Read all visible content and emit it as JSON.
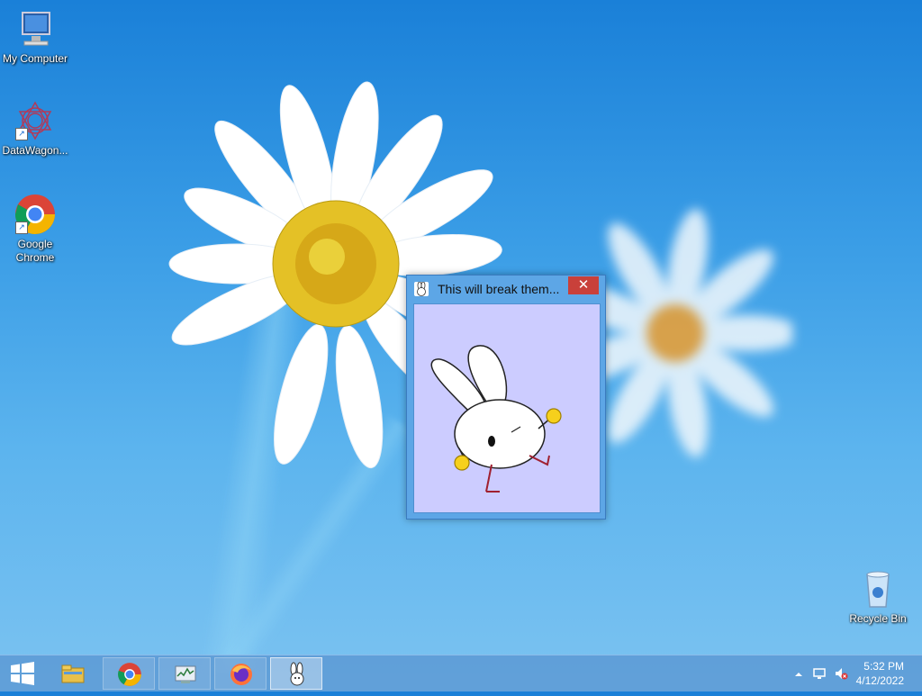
{
  "desktop": {
    "icons": [
      {
        "label": "My Computer",
        "icon": "computer-icon"
      },
      {
        "label": "DataWagon...",
        "icon": "datawagon-icon"
      },
      {
        "label_line1": "Google",
        "label_line2": "Chrome",
        "icon": "chrome-icon"
      },
      {
        "label": "Recycle Bin",
        "icon": "recycle-bin-icon"
      }
    ]
  },
  "window": {
    "title": "This will break them...",
    "close_label": "✕",
    "background": "#ccccff"
  },
  "taskbar": {
    "start_icon": "windows-logo-icon",
    "items": [
      {
        "icon": "file-explorer-icon"
      },
      {
        "icon": "chrome-icon"
      },
      {
        "icon": "task-manager-icon"
      },
      {
        "icon": "firefox-icon"
      },
      {
        "icon": "bunny-app-icon"
      }
    ],
    "tray": {
      "time": "5:32 PM",
      "date": "4/12/2022",
      "icons": [
        "show-hidden-icons-icon",
        "network-icon",
        "volume-muted-icon"
      ]
    }
  },
  "colors": {
    "accent_blue": "#1a80d8",
    "close_red": "#c9403a",
    "window_frame": "#5da6e6"
  }
}
